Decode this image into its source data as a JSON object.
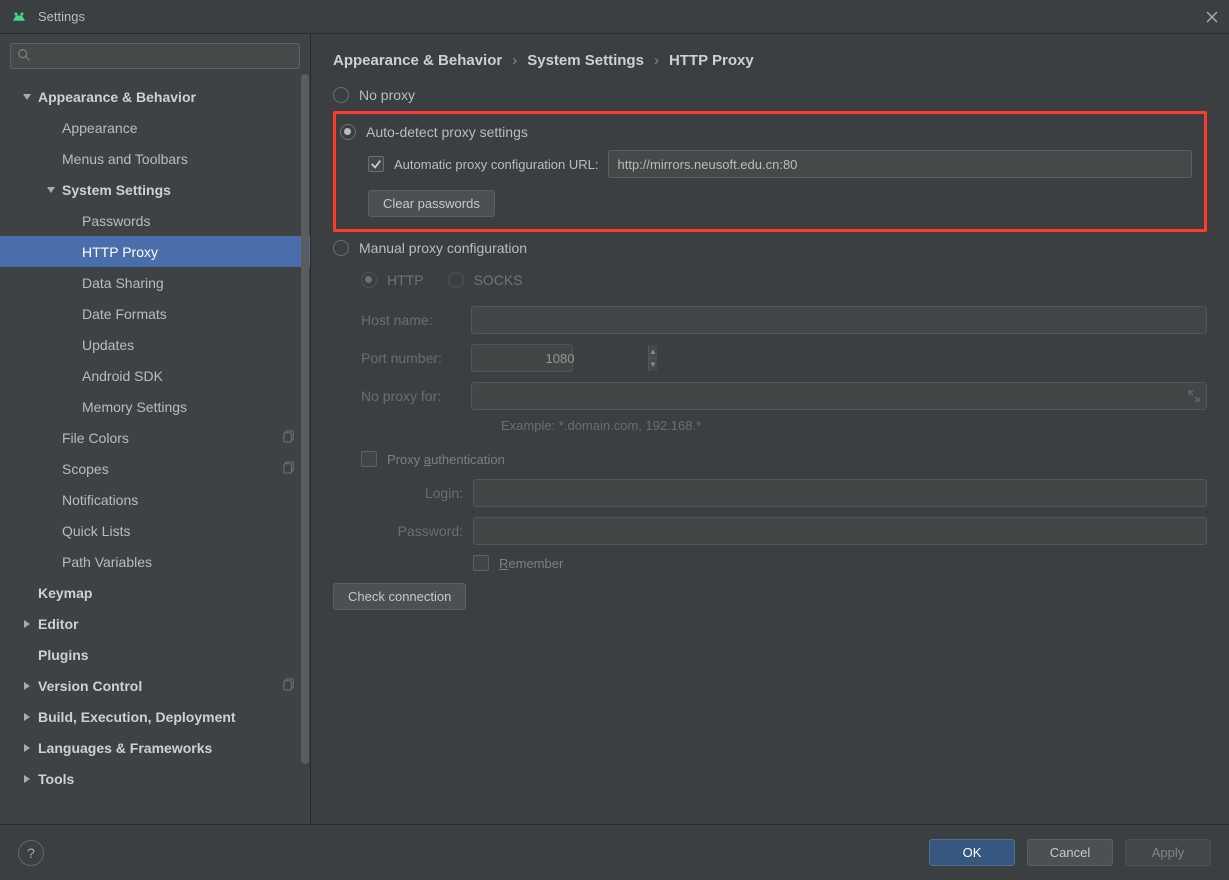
{
  "window": {
    "title": "Settings"
  },
  "breadcrumb": [
    "Appearance & Behavior",
    "System Settings",
    "HTTP Proxy"
  ],
  "sidebar": [
    {
      "label": "Appearance & Behavior",
      "indent": 0,
      "arrow": "down",
      "bold": true
    },
    {
      "label": "Appearance",
      "indent": 1,
      "arrow": "none"
    },
    {
      "label": "Menus and Toolbars",
      "indent": 1,
      "arrow": "none"
    },
    {
      "label": "System Settings",
      "indent": 1,
      "arrow": "down",
      "bold": true
    },
    {
      "label": "Passwords",
      "indent": 2,
      "arrow": "none"
    },
    {
      "label": "HTTP Proxy",
      "indent": 2,
      "arrow": "none",
      "selected": true
    },
    {
      "label": "Data Sharing",
      "indent": 2,
      "arrow": "none"
    },
    {
      "label": "Date Formats",
      "indent": 2,
      "arrow": "none"
    },
    {
      "label": "Updates",
      "indent": 2,
      "arrow": "none"
    },
    {
      "label": "Android SDK",
      "indent": 2,
      "arrow": "none"
    },
    {
      "label": "Memory Settings",
      "indent": 2,
      "arrow": "none"
    },
    {
      "label": "File Colors",
      "indent": 1,
      "arrow": "none",
      "copy": true
    },
    {
      "label": "Scopes",
      "indent": 1,
      "arrow": "none",
      "copy": true
    },
    {
      "label": "Notifications",
      "indent": 1,
      "arrow": "none"
    },
    {
      "label": "Quick Lists",
      "indent": 1,
      "arrow": "none"
    },
    {
      "label": "Path Variables",
      "indent": 1,
      "arrow": "none"
    },
    {
      "label": "Keymap",
      "indent": 0,
      "arrow": "blank",
      "bold": true
    },
    {
      "label": "Editor",
      "indent": 0,
      "arrow": "right",
      "bold": true
    },
    {
      "label": "Plugins",
      "indent": 0,
      "arrow": "blank",
      "bold": true
    },
    {
      "label": "Version Control",
      "indent": 0,
      "arrow": "right",
      "bold": true,
      "copy": true
    },
    {
      "label": "Build, Execution, Deployment",
      "indent": 0,
      "arrow": "right",
      "bold": true
    },
    {
      "label": "Languages & Frameworks",
      "indent": 0,
      "arrow": "right",
      "bold": true
    },
    {
      "label": "Tools",
      "indent": 0,
      "arrow": "right",
      "bold": true
    }
  ],
  "proxy": {
    "no_proxy": "No proxy",
    "auto_detect": "Auto-detect proxy settings",
    "pac_url_label": "Automatic proxy configuration URL:",
    "pac_url_value": "http://mirrors.neusoft.edu.cn:80",
    "clear_passwords": "Clear passwords",
    "manual": "Manual proxy configuration",
    "http": "HTTP",
    "socks": "SOCKS",
    "host_label": "Host name:",
    "host_value": "",
    "port_label": "Port number:",
    "port_value": "1080",
    "no_proxy_for_label": "No proxy for:",
    "no_proxy_for_value": "",
    "example": "Example: *.domain.com, 192.168.*",
    "proxy_auth_label_a": "Proxy ",
    "proxy_auth_label_u": "a",
    "proxy_auth_label_b": "uthentication",
    "login_label": "Login:",
    "login_value": "",
    "password_label": "Password:",
    "password_value": "",
    "remember_u": "R",
    "remember_rest": "emember",
    "check_connection": "Check connection"
  },
  "footer": {
    "ok": "OK",
    "cancel": "Cancel",
    "apply": "Apply"
  }
}
